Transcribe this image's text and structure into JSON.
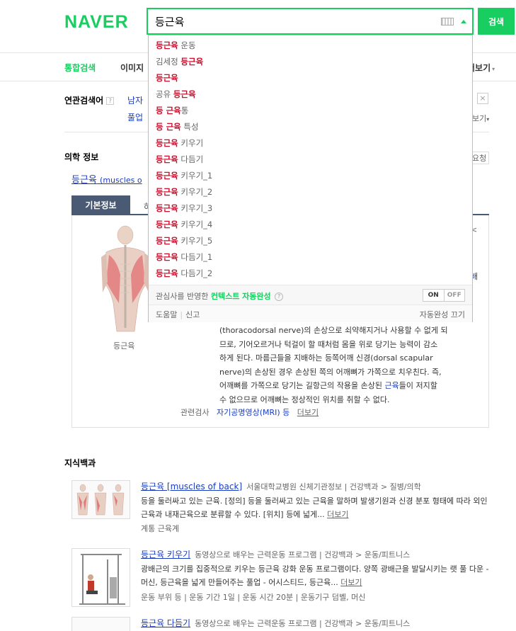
{
  "header": {
    "logo": "NAVER",
    "search_value": "등근육",
    "search_button": "검색"
  },
  "tabs": {
    "items": [
      "통합검색",
      "이미지"
    ],
    "more": "더보기"
  },
  "related_search": {
    "title": "연관검색어",
    "help": "?",
    "kw1": "남자",
    "kw2": "풀업",
    "close": "×",
    "fold": "보기"
  },
  "medical": {
    "section_title": "의학 정보",
    "request": "요청",
    "term": "등근육",
    "term_en": "(muscles o",
    "tab_basic": "기본정보",
    "tab_other": "하",
    "caption": "등근육",
    "stray_1": "<",
    "stray_2": "배",
    "stray_3": "|",
    "lines": [
      "(thoracodorsal nerve)의 손상으로 쇠약해지거나 사용할 수 없게 되",
      "므로, 기어오르거나 턱걸이 할 때처럼 몸을 위로 당기는 능력이 감소",
      "하게 된다. 마름근들을 지배하는 등쪽어깨 신경(dorsal scapular",
      "nerve)의 손상된 경우 손상된 쪽의 어깨뼈가 가쪽으로 치우친다. 즉,"
    ],
    "line5_a": "어깨뼈를 가쪽으로 당기는 길항근의 작용을 손상된 ",
    "line5_link": "근육",
    "line5_b": "들이 저지할",
    "line6": "수 없으므로 어깨뼈는 정상적인 위치를 취할 수 없다.",
    "related_label": "관련검사",
    "related_link": "자기공명영상(MRI) 등",
    "more": "더보기"
  },
  "encyclopedia": {
    "section_title": "지식백과",
    "items": [
      {
        "title": "등근육 [muscles of back]",
        "source": "서울대학교병원 신체기관정보 | 건강백과 > 질병/의학",
        "desc": "등을 둘러싸고 있는 근육. [정의] 등을 둘러싸고 있는 근육을 말하며 발생기원과 신경 분포 형태에 따라 외인근육과 내재근육으로 분류할 수 있다. [위치] 등에 넓게...",
        "more": "더보기",
        "meta": "계통  근육계"
      },
      {
        "title": "등근육 키우기",
        "source": "동영상으로 배우는 근력운동 프로그램 | 건강백과 > 운동/피트니스",
        "desc": "광배근의 크기를 집중적으로 키우는 등근육 강화 운동 프로그램이다. 양쪽 광배근을 발달시키는 랫 풀 다운 - 머신, 등근육을 넓게 만들어주는 풀업 - 어시스티드, 등근육...",
        "more": "더보기",
        "meta": "운동 부위  등  |  운동 기간  1일  |  운동 시간  20분  |  운동기구  덤벨, 머신"
      },
      {
        "title": "등근육 다듬기",
        "source": "동영상으로 배우는 근력운동 프로그램 | 건강백과 > 운동/피트니스"
      }
    ]
  },
  "autocomplete": {
    "items": [
      {
        "pre": "",
        "hl": "등근육",
        "post": " 운동"
      },
      {
        "pre": "김세정 ",
        "hl": "등근육",
        "post": ""
      },
      {
        "pre": "",
        "hl": "등근육",
        "post": ""
      },
      {
        "pre": "공유 ",
        "hl": "등근육",
        "post": ""
      },
      {
        "pre": "",
        "hl": "등 근육",
        "post": "통"
      },
      {
        "pre": "",
        "hl": "등 근육",
        "post": " 특성"
      },
      {
        "pre": "",
        "hl": "등근육",
        "post": " 키우기"
      },
      {
        "pre": "",
        "hl": "등근육",
        "post": " 다듬기"
      },
      {
        "pre": "",
        "hl": "등근육",
        "post": " 키우기_1"
      },
      {
        "pre": "",
        "hl": "등근육",
        "post": " 키우기_2"
      },
      {
        "pre": "",
        "hl": "등근육",
        "post": " 키우기_3"
      },
      {
        "pre": "",
        "hl": "등근육",
        "post": " 키우기_4"
      },
      {
        "pre": "",
        "hl": "등근육",
        "post": " 키우기_5"
      },
      {
        "pre": "",
        "hl": "등근육",
        "post": " 다듬기_1"
      },
      {
        "pre": "",
        "hl": "등근육",
        "post": " 다듬기_2"
      }
    ],
    "option_text": "관심사를 반영한 ",
    "option_highlight": "컨텍스트 자동완성",
    "option_help": "?",
    "on": "ON",
    "off": "OFF",
    "help": "도움말",
    "report": "신고",
    "turn_off": "자동완성 끄기"
  },
  "colors": {
    "brand": "#19ce60",
    "link": "#1a3dc1",
    "highlight": "#c8102e"
  }
}
